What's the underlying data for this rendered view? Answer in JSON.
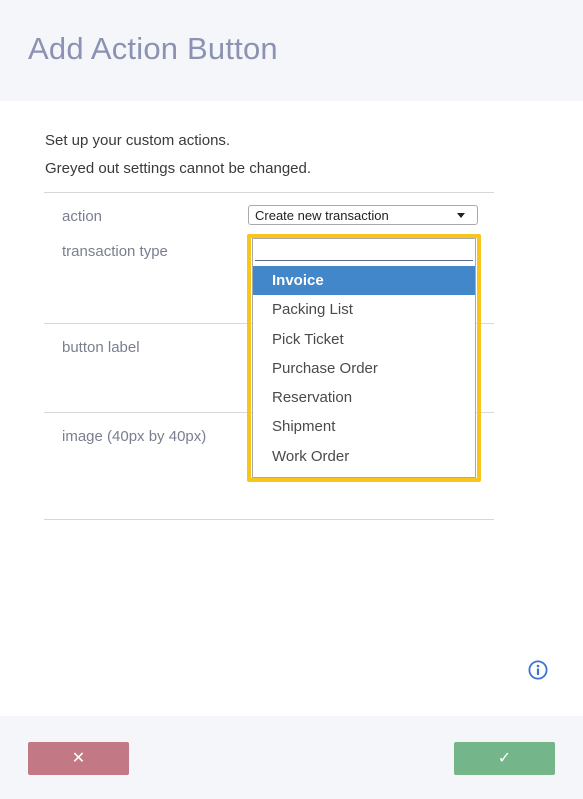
{
  "dialog": {
    "title": "Add Action Button",
    "intro_line1": "Set up your custom actions.",
    "intro_line2": "Greyed out settings cannot be changed."
  },
  "form": {
    "action_label": "action",
    "action_value": "Create new transaction",
    "transaction_type_label": "transaction type",
    "button_label_label": "button label",
    "image_label": "image (40px by 40px)"
  },
  "dropdown": {
    "search_value": "",
    "selected": "Invoice",
    "options": [
      "Invoice",
      "Packing List",
      "Pick Ticket",
      "Purchase Order",
      "Reservation",
      "Shipment",
      "Work Order"
    ]
  },
  "footer": {
    "cancel_icon": "✕",
    "confirm_icon": "✓"
  },
  "icons": {
    "info": "info-icon",
    "cancel": "close-icon",
    "confirm": "check-icon",
    "caret": "chevron-down-icon"
  },
  "colors": {
    "highlight_border": "#f7c51b",
    "selected_option_bg": "#4287c9",
    "cancel_button": "#c27985",
    "confirm_button": "#74b68a",
    "title_text": "#8b92b2",
    "info_icon": "#3b73d4"
  }
}
